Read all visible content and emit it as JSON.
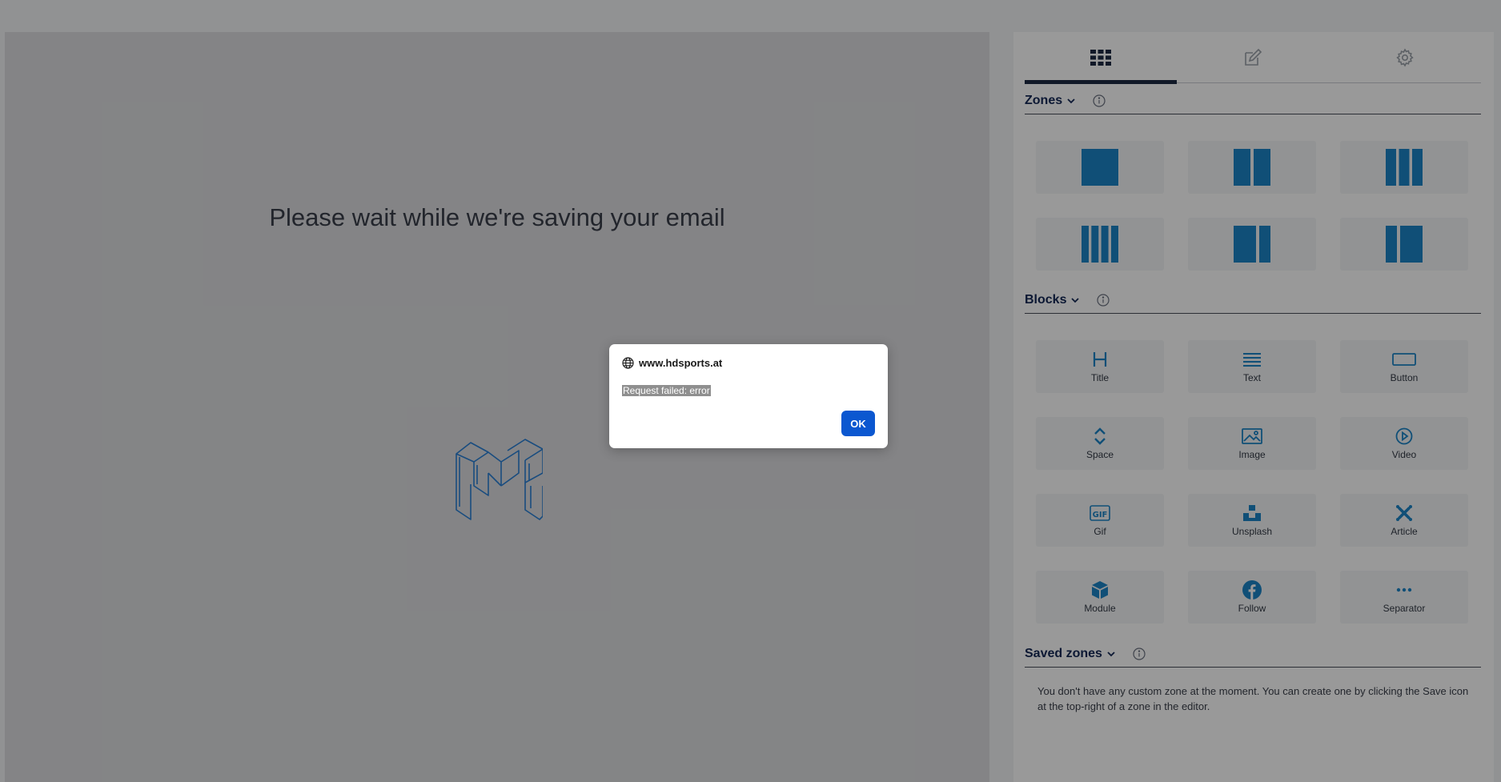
{
  "canvas": {
    "message": "Please wait while we're saving your email",
    "logo_icon": "brand-m-logo-icon"
  },
  "panel": {
    "tabs": [
      {
        "icon": "grid-icon",
        "active": true
      },
      {
        "icon": "edit-icon",
        "active": false
      },
      {
        "icon": "settings-icon",
        "active": false
      }
    ],
    "zones": {
      "label": "Zones",
      "layouts": [
        "one-column",
        "two-columns",
        "three-columns",
        "four-columns",
        "wide-narrow",
        "narrow-wide"
      ]
    },
    "blocks": {
      "label": "Blocks",
      "items": [
        {
          "label": "Title",
          "icon": "title-h-icon"
        },
        {
          "label": "Text",
          "icon": "text-lines-icon"
        },
        {
          "label": "Button",
          "icon": "button-rect-icon"
        },
        {
          "label": "Space",
          "icon": "space-arrows-icon"
        },
        {
          "label": "Image",
          "icon": "image-icon"
        },
        {
          "label": "Video",
          "icon": "video-play-icon"
        },
        {
          "label": "Gif",
          "icon": "gif-icon"
        },
        {
          "label": "Unsplash",
          "icon": "unsplash-icon"
        },
        {
          "label": "Article",
          "icon": "joomla-icon"
        },
        {
          "label": "Module",
          "icon": "cube-icon"
        },
        {
          "label": "Follow",
          "icon": "facebook-icon"
        },
        {
          "label": "Separator",
          "icon": "dots-icon"
        }
      ]
    },
    "saved_zones": {
      "label": "Saved zones",
      "note": "You don't have any custom zone at the moment. You can create one by clicking the Save icon at the top-right of a zone in the editor."
    }
  },
  "dialog": {
    "host": "www.hdsports.at",
    "message": "Request failed: error",
    "ok_label": "OK"
  },
  "colors": {
    "accent": "#1b84c7",
    "section_heading": "#142856",
    "ok_button": "#0b57d0"
  }
}
